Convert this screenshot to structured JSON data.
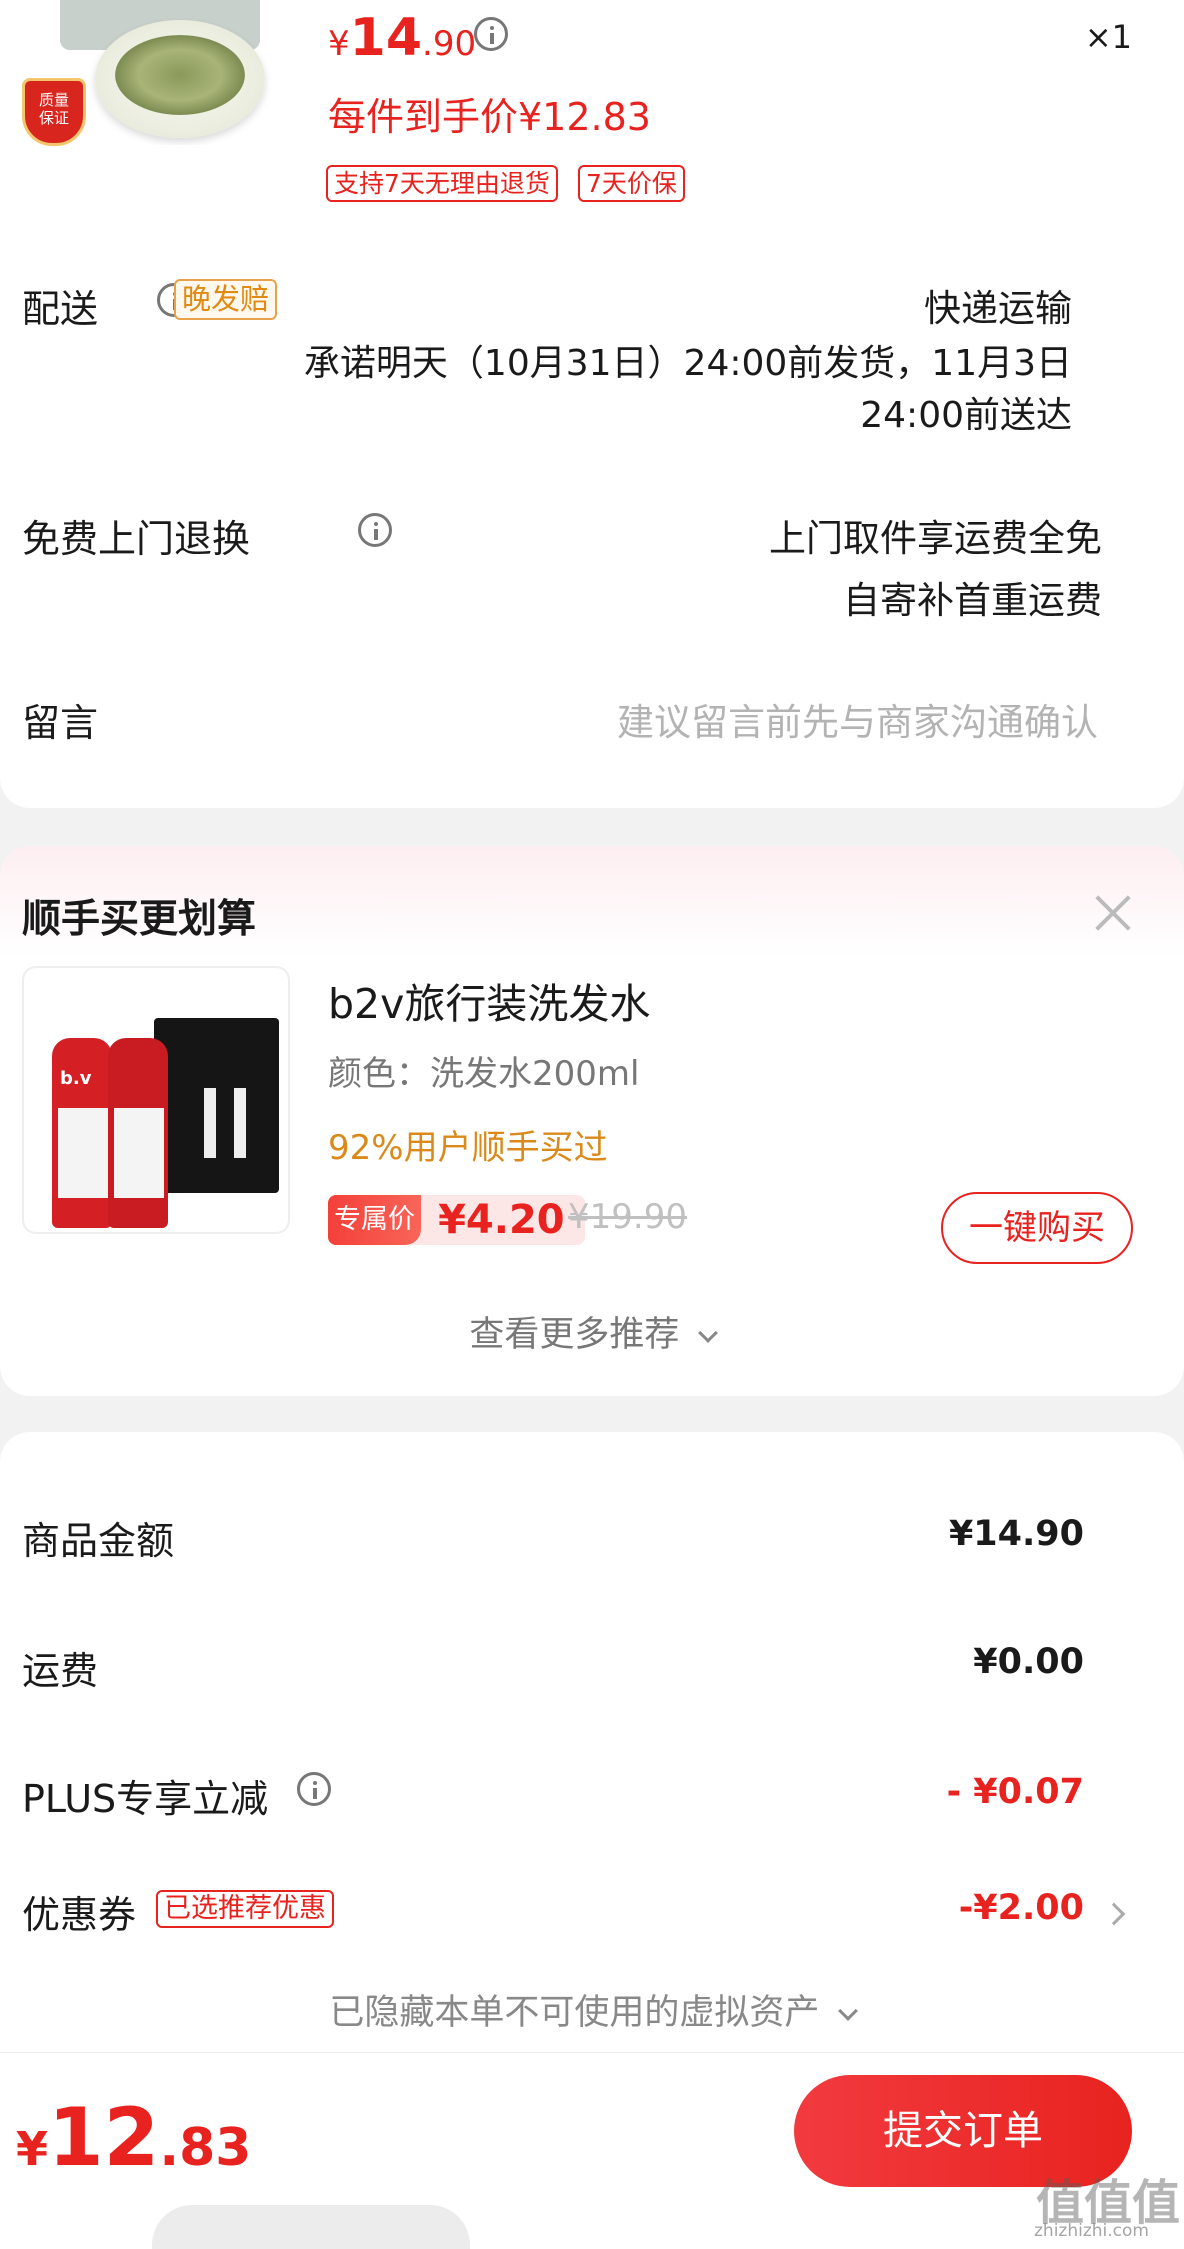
{
  "product": {
    "badge_line1": "质量",
    "badge_line2": "保证",
    "price_symbol": "¥",
    "price_int": "14",
    "price_dec": ".90",
    "quantity": "×1",
    "final_price_text": "每件到手价¥12.83",
    "tags": [
      "支持7天无理由退货",
      "7天价保"
    ]
  },
  "delivery": {
    "label": "配送",
    "badge": "晚发赔",
    "method": "快递运输",
    "promise_line1": "承诺明天（10月31日）24:00前发货，11月3日",
    "promise_line2": "24:00前送达"
  },
  "returns": {
    "label": "免费上门退换",
    "line1": "上门取件享运费全免",
    "line2": "自寄补首重运费"
  },
  "message": {
    "label": "留言",
    "placeholder": "建议留言前先与商家沟通确认"
  },
  "addon": {
    "title": "顺手买更划算",
    "close_icon": "close-icon",
    "product_name": "b2v旅行装洗发水",
    "spec": "颜色：洗发水200ml",
    "social_proof": "92%用户顺手买过",
    "price_badge": "专属价",
    "price": "¥4.20",
    "original_price": "¥19.90",
    "buy_button": "一键购买",
    "bottle_brand": "b.v",
    "more": "查看更多推荐"
  },
  "summary": {
    "rows": [
      {
        "label": "商品金额",
        "value": "¥14.90"
      },
      {
        "label": "运费",
        "value": "¥0.00"
      },
      {
        "label": "PLUS专享立减",
        "value": "- ¥0.07"
      },
      {
        "label": "优惠券",
        "badge": "已选推荐优惠",
        "value": "-¥2.00"
      }
    ],
    "hidden_assets": "已隐藏本单不可使用的虚拟资产"
  },
  "footer": {
    "total_symbol": "¥",
    "total_int": "12",
    "total_dec": ".83",
    "submit": "提交订单"
  },
  "watermark": {
    "main": "值值值",
    "sub": "zhizhizhi.com"
  },
  "colors": {
    "accent": "#e8231f",
    "orange": "#e18a12",
    "text_gray": "#777777"
  }
}
